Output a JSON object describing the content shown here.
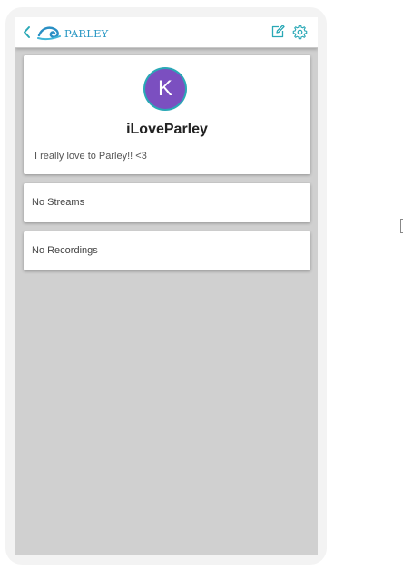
{
  "header": {
    "logo_text": "PARLEY"
  },
  "profile": {
    "avatar_letter": "K",
    "username": "iLoveParley",
    "bio": "I really love to Parley!! <3"
  },
  "streams": {
    "empty_text": "No Streams"
  },
  "recordings": {
    "empty_text": "No Recordings"
  },
  "colors": {
    "accent": "#2aa8b6",
    "avatar_bg": "#7b4fc0",
    "screen_bg": "#d0d0d0"
  },
  "icons": {
    "back": "chevron-left-icon",
    "edit": "edit-icon",
    "settings": "gear-icon"
  }
}
